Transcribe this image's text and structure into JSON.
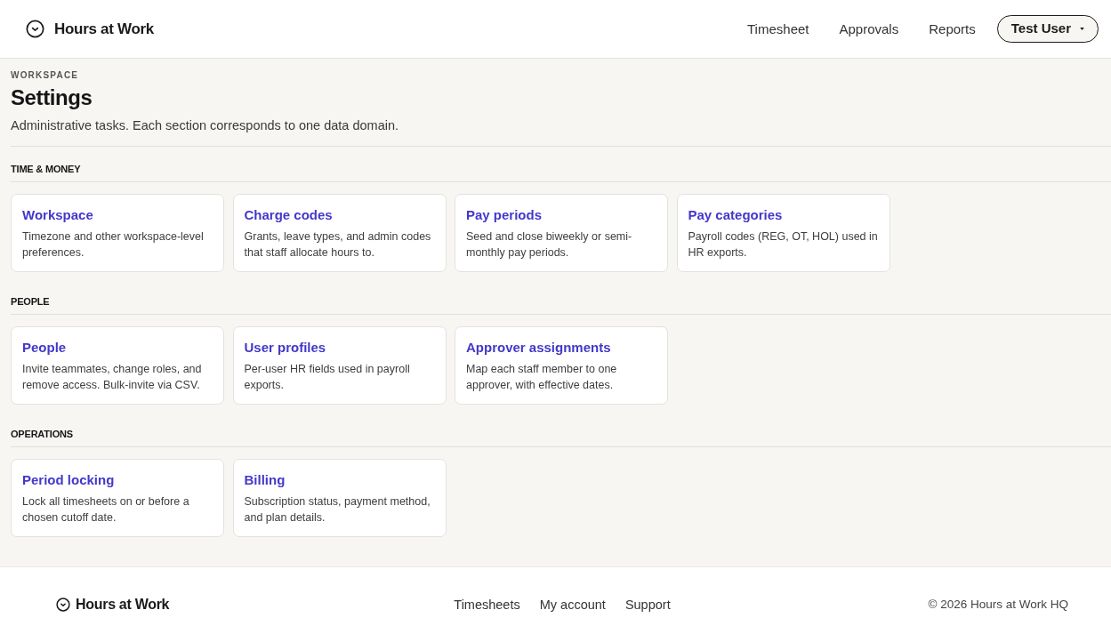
{
  "header": {
    "brand": "Hours at Work",
    "nav": [
      {
        "label": "Timesheet"
      },
      {
        "label": "Approvals"
      },
      {
        "label": "Reports"
      }
    ],
    "user_menu": "Test User"
  },
  "page": {
    "eyebrow": "WORKSPACE",
    "title": "Settings",
    "description": "Administrative tasks. Each section corresponds to one data domain."
  },
  "sections": [
    {
      "heading": "TIME & MONEY",
      "cards": [
        {
          "title": "Workspace",
          "description": "Timezone and other workspace-level preferences."
        },
        {
          "title": "Charge codes",
          "description": "Grants, leave types, and admin codes that staff allocate hours to."
        },
        {
          "title": "Pay periods",
          "description": "Seed and close biweekly or semi-monthly pay periods."
        },
        {
          "title": "Pay categories",
          "description": "Payroll codes (REG, OT, HOL) used in HR exports."
        }
      ]
    },
    {
      "heading": "PEOPLE",
      "cards": [
        {
          "title": "People",
          "description": "Invite teammates, change roles, and remove access. Bulk-invite via CSV."
        },
        {
          "title": "User profiles",
          "description": "Per-user HR fields used in payroll exports."
        },
        {
          "title": "Approver assignments",
          "description": "Map each staff member to one approver, with effective dates."
        }
      ]
    },
    {
      "heading": "OPERATIONS",
      "cards": [
        {
          "title": "Period locking",
          "description": "Lock all timesheets on or before a chosen cutoff date."
        },
        {
          "title": "Billing",
          "description": "Subscription status, payment method, and plan details."
        }
      ]
    }
  ],
  "footer": {
    "brand": "Hours at Work",
    "links": [
      {
        "label": "Timesheets"
      },
      {
        "label": "My account"
      },
      {
        "label": "Support"
      }
    ],
    "copyright": "© 2026 Hours at Work HQ"
  }
}
